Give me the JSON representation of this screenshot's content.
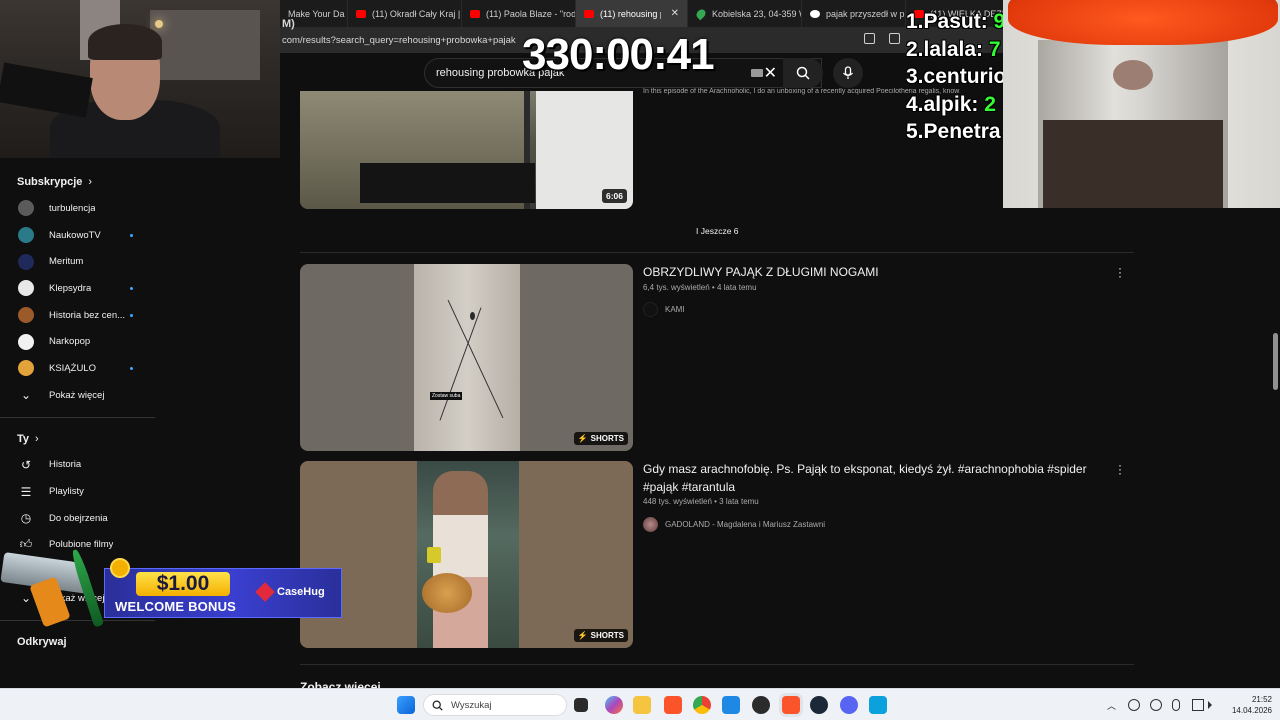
{
  "browser": {
    "tabs": [
      {
        "title": "Make Your Da",
        "favicon": "youtube-icon"
      },
      {
        "title": "(11) Okradł Cały Kraj | :",
        "favicon": "youtube-icon"
      },
      {
        "title": "(11) Paola Blaze - \"rod",
        "favicon": "youtube-icon"
      },
      {
        "title": "(11) rehousing pro",
        "favicon": "youtube-icon",
        "active": true
      },
      {
        "title": "Kobielska 23, 04-359 W",
        "favicon": "maps-icon"
      },
      {
        "title": "pajak przyszedł w proś",
        "favicon": "google-icon"
      },
      {
        "title": "(11) WIELKA DEZI",
        "favicon": "youtube-icon"
      }
    ],
    "url": "com/results?search_query=rehousing+probowka+pajak",
    "url_prefix": "M)"
  },
  "search": {
    "query": "rehousing probowka pajak"
  },
  "overlay": {
    "timer": "330:00:41",
    "leaderboard": [
      {
        "rank_name": "1.Pasut:",
        "score": "9"
      },
      {
        "rank_name": "2.lalala:",
        "score": "7"
      },
      {
        "rank_name": "3.centurio",
        "score": ""
      },
      {
        "rank_name": "4.alpik:",
        "score": "2"
      },
      {
        "rank_name": "5.Penetra",
        "score": ""
      }
    ],
    "ad": {
      "amount": "$1.00",
      "bonus": "WELCOME BONUS",
      "brand": "CaseHug"
    }
  },
  "sidebar": {
    "subscriptions_title": "Subskrypcje",
    "subscriptions": [
      {
        "label": "turbulencja",
        "avatar_color": "#5b5b5b",
        "new": false
      },
      {
        "label": "NaukowoTV",
        "avatar_color": "#2b7a8a",
        "new": true
      },
      {
        "label": "Meritum",
        "avatar_color": "#1f2a5a",
        "new": false
      },
      {
        "label": "Klepsydra",
        "avatar_color": "#e8e8e8",
        "new": true
      },
      {
        "label": "Historia bez cen...",
        "avatar_color": "#9a5a2a",
        "new": true
      },
      {
        "label": "Narkopop",
        "avatar_color": "#f1f1f1",
        "new": false
      },
      {
        "label": "KSIĄŻULO",
        "avatar_color": "#e3a23a",
        "new": true
      }
    ],
    "show_more_1": "Pokaż więcej",
    "you_title": "Ty",
    "you_items": [
      {
        "label": "Historia",
        "icon": "history-icon"
      },
      {
        "label": "Playlisty",
        "icon": "playlist-icon"
      },
      {
        "label": "Do obejrzenia",
        "icon": "watch-later-icon"
      },
      {
        "label": "Polubione filmy",
        "icon": "like-icon"
      },
      {
        "label": "",
        "icon": "download-icon"
      }
    ],
    "show_more_2": "Pokaż więcej",
    "explore_title": "Odkrywaj"
  },
  "results": {
    "top_video": {
      "description": "In this episode of the Arachnoholic, I do an unboxing of a recently acquired Poecilotheria regalis, know",
      "duration": "6:06"
    },
    "more_label": "I Jeszcze 6",
    "shorts": [
      {
        "title": "OBRZYDLIWY PAJĄK Z DŁUGIMI NOGAMI",
        "views": "6,4 tys. wyświetleń",
        "age": "4 lata temu",
        "channel": "KAMI",
        "badge": "SHORTS",
        "thumb_caption": "Zostaw suba"
      },
      {
        "title": "Gdy masz arachnofobię. Ps. Pająk to eksponat, kiedyś żył. #arachnophobia #spider #pająk #tarantula",
        "views": "448 tys. wyświetleń",
        "age": "3 lata temu",
        "channel": "GADOLAND - Magdalena i Mariusz Zastawni",
        "badge": "SHORTS"
      }
    ],
    "meta_sep": " • ",
    "see_more": "Zobacz więcej"
  },
  "taskbar": {
    "search_placeholder": "Wyszukaj",
    "time": "21:52",
    "date": "14.04.2026"
  }
}
